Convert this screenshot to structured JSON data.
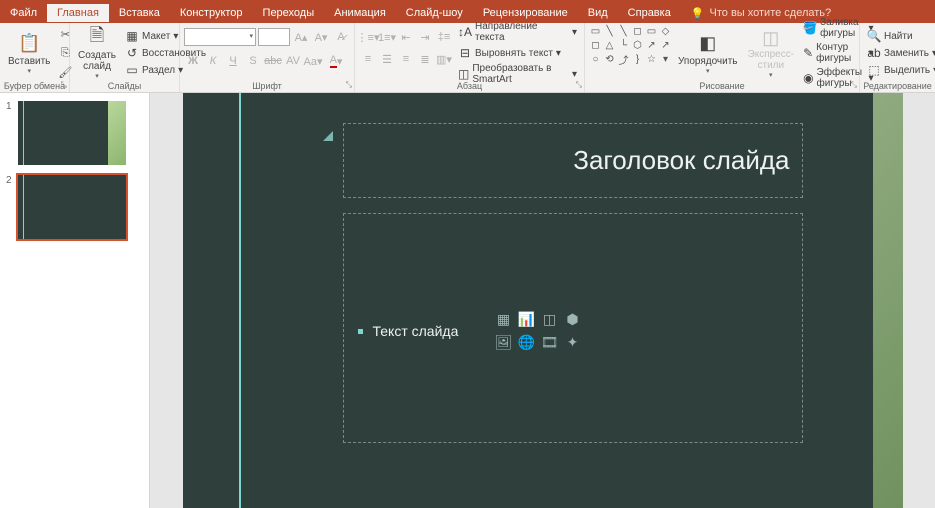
{
  "tabs": {
    "file": "Файл",
    "home": "Главная",
    "insert": "Вставка",
    "design": "Конструктор",
    "transitions": "Переходы",
    "animations": "Анимация",
    "slideshow": "Слайд-шоу",
    "review": "Рецензирование",
    "view": "Вид",
    "help": "Справка",
    "tellme": "Что вы хотите сделать?"
  },
  "ribbon": {
    "clipboard": {
      "label": "Буфер обмена",
      "paste": "Вставить"
    },
    "slides": {
      "label": "Слайды",
      "new_slide": "Создать слайд",
      "layout": "Макет",
      "reset": "Восстановить",
      "section": "Раздел"
    },
    "font": {
      "label": "Шрифт"
    },
    "paragraph": {
      "label": "Абзац",
      "text_direction": "Направление текста",
      "align_text": "Выровнять текст",
      "smartart": "Преобразовать в SmartArt"
    },
    "drawing": {
      "label": "Рисование",
      "arrange": "Упорядочить",
      "quick_styles": "Экспресс-стили",
      "shape_fill": "Заливка фигуры",
      "shape_outline": "Контур фигуры",
      "shape_effects": "Эффекты фигуры"
    },
    "editing": {
      "label": "Редактирование",
      "find": "Найти",
      "replace": "Заменить",
      "select": "Выделить"
    }
  },
  "thumbnails": [
    {
      "num": "1",
      "selected": false
    },
    {
      "num": "2",
      "selected": true
    }
  ],
  "slide": {
    "title_placeholder": "Заголовок слайда",
    "content_placeholder": "Текст слайда"
  }
}
